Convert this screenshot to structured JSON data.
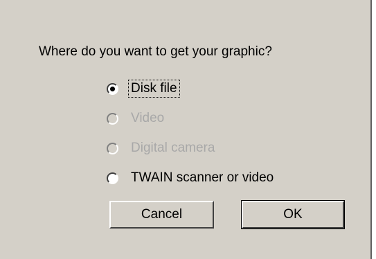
{
  "dialog": {
    "question": "Where do you want to get your graphic?",
    "options": [
      {
        "label": "Disk file",
        "selected": true,
        "enabled": true
      },
      {
        "label": "Video",
        "selected": false,
        "enabled": false
      },
      {
        "label": "Digital camera",
        "selected": false,
        "enabled": false
      },
      {
        "label": "TWAIN scanner or video",
        "selected": false,
        "enabled": true
      }
    ],
    "buttons": {
      "cancel_label": "Cancel",
      "ok_label": "OK"
    }
  }
}
